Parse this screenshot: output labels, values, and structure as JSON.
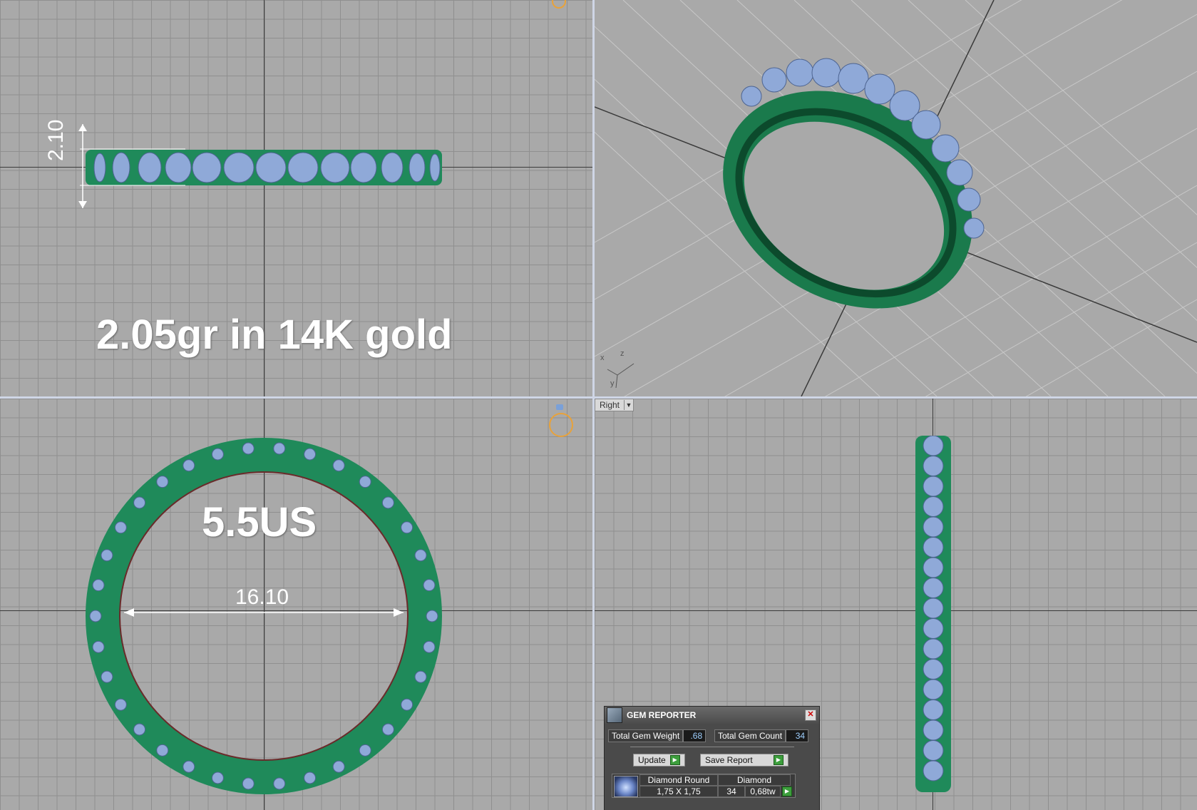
{
  "viewports": {
    "front": {
      "overlay_text": "2.05gr in 14K gold",
      "dimension": "2.10"
    },
    "perspective": {
      "axis_labels": [
        "x",
        "z",
        "y"
      ]
    },
    "top": {
      "overlay_text": "5.5US",
      "dimension": "16.10"
    },
    "right": {
      "view_label": "Right"
    }
  },
  "gem_reporter": {
    "title": "GEM REPORTER",
    "total_weight_label": "Total Gem Weight",
    "total_weight_value": ".68",
    "total_count_label": "Total Gem Count",
    "total_count_value": "34",
    "update_label": "Update",
    "save_report_label": "Save Report",
    "gem_row": {
      "name": "Diamond Round",
      "size": "1,75 X 1,75",
      "material": "Diamond",
      "count": "34",
      "weight": "0,68tw"
    }
  },
  "colors": {
    "metal": "#1f8a5a",
    "gem": "#8fa9d8",
    "grid_bg": "#a9a9a9",
    "divider": "#cfd6e6"
  }
}
